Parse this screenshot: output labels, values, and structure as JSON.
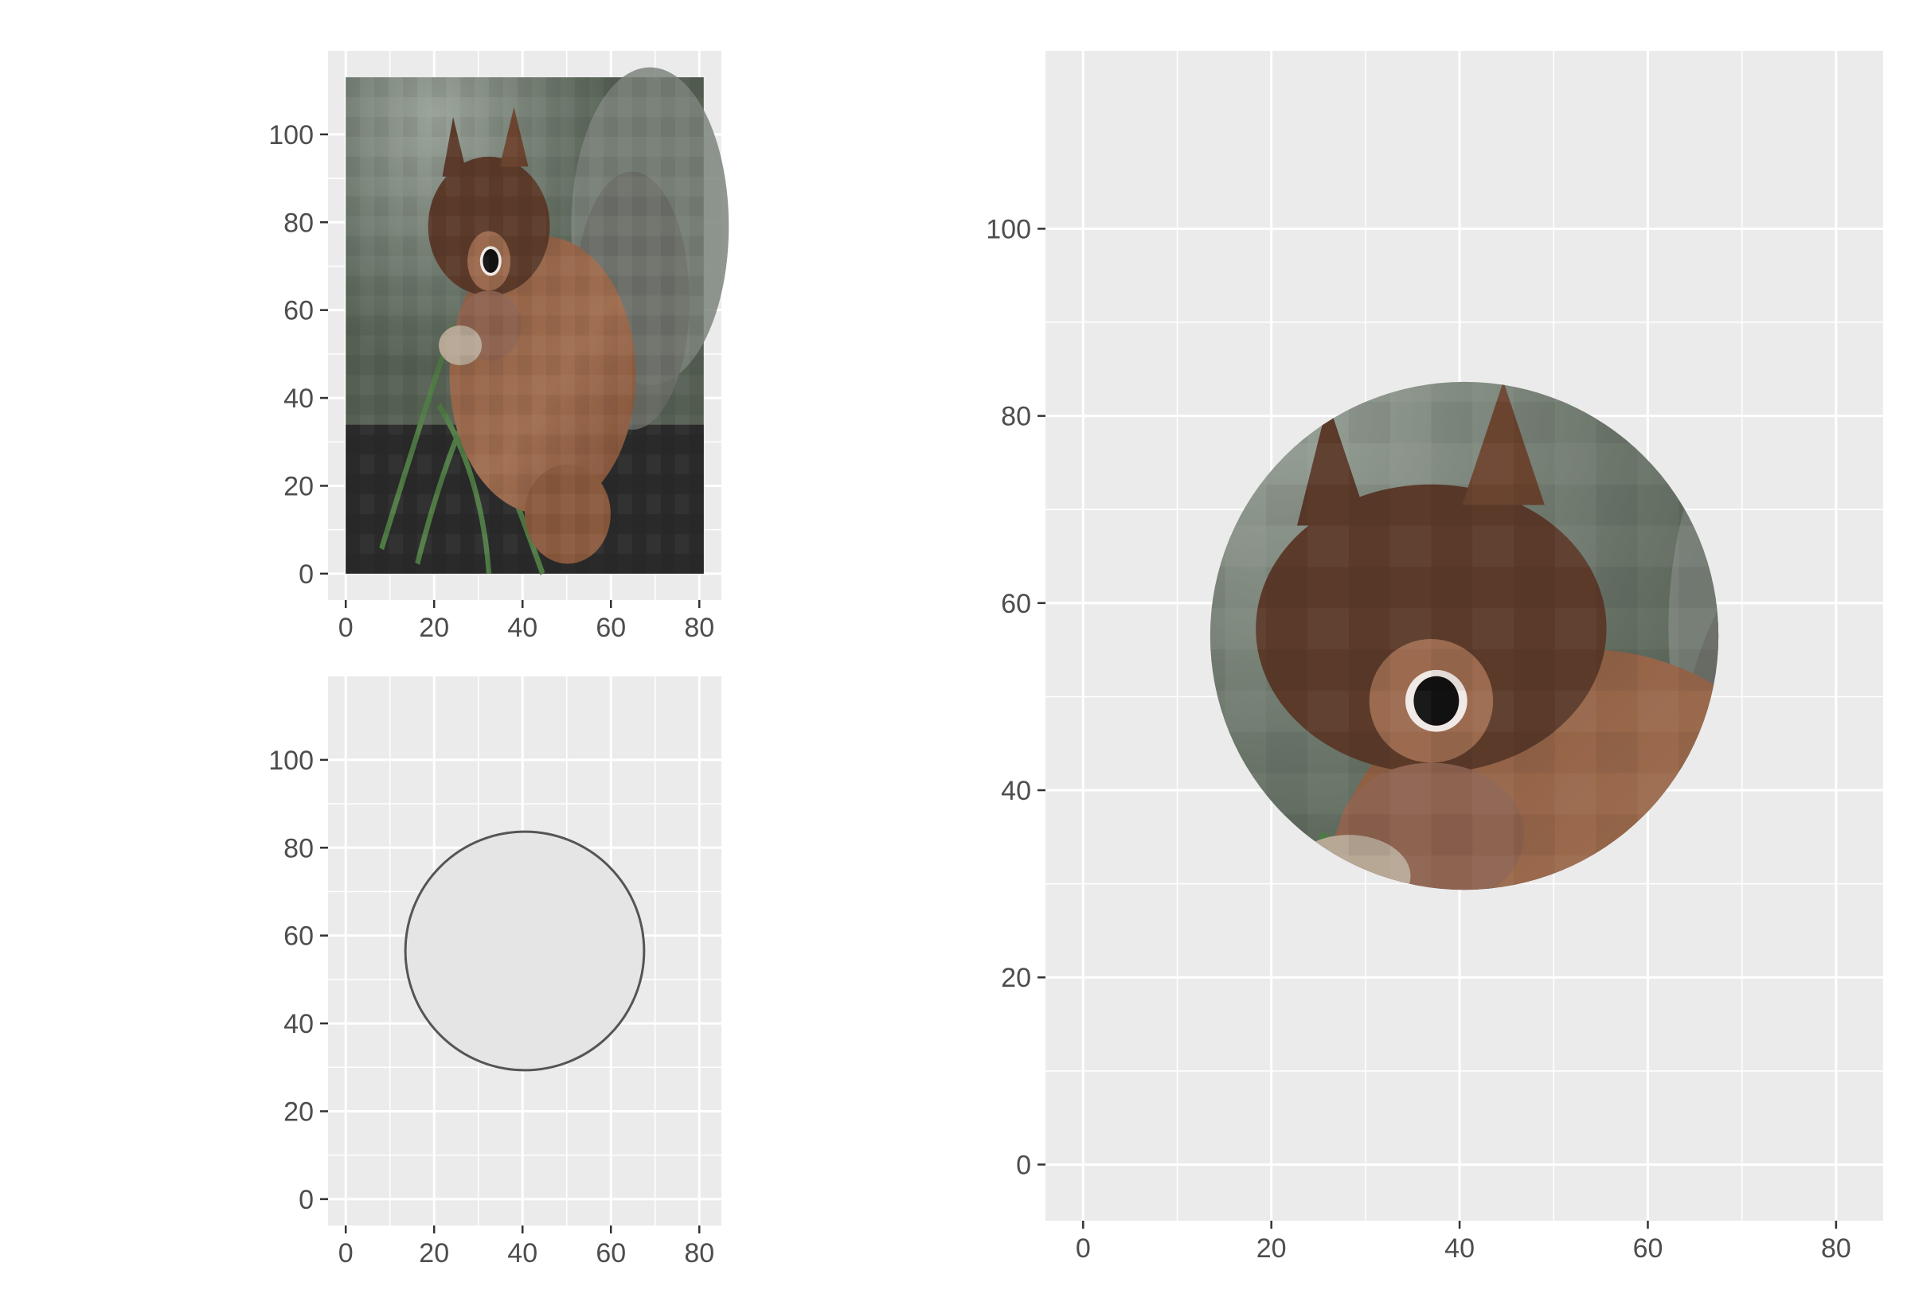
{
  "colors": {
    "panel_background": "#ebebeb",
    "grid_line": "#ffffff",
    "tick_mark": "#333333",
    "tick_text": "#4d4d4d",
    "circle_fill": "#e5e5e5",
    "circle_stroke": "#555555"
  },
  "chart_data": [
    {
      "id": "raster-image-panel",
      "type": "image",
      "xlim": [
        -4,
        85
      ],
      "ylim": [
        -6,
        119
      ],
      "x_ticks": [
        0,
        20,
        40,
        60,
        80
      ],
      "x_tick_labels": [
        "0",
        "20",
        "40",
        "60",
        "80"
      ],
      "y_ticks": [
        0,
        20,
        40,
        60,
        80,
        100
      ],
      "y_tick_labels": [
        "0",
        "20",
        "40",
        "60",
        "80",
        "100"
      ],
      "image_extent": {
        "x": [
          0,
          81
        ],
        "y": [
          0,
          113
        ]
      },
      "image_content": "squirrel photo",
      "grid": true
    },
    {
      "id": "circle-outline-panel",
      "type": "shape",
      "xlim": [
        -4,
        85
      ],
      "ylim": [
        -6,
        119
      ],
      "x_ticks": [
        0,
        20,
        40,
        60,
        80
      ],
      "x_tick_labels": [
        "0",
        "20",
        "40",
        "60",
        "80"
      ],
      "y_ticks": [
        0,
        20,
        40,
        60,
        80,
        100
      ],
      "y_tick_labels": [
        "0",
        "20",
        "40",
        "60",
        "80",
        "100"
      ],
      "circle": {
        "cx": 40.5,
        "cy": 56.5,
        "r": 27
      },
      "grid": true
    },
    {
      "id": "masked-image-panel",
      "type": "image",
      "xlim": [
        -4,
        85
      ],
      "ylim": [
        -6,
        119
      ],
      "x_ticks": [
        0,
        20,
        40,
        60,
        80
      ],
      "x_tick_labels": [
        "0",
        "20",
        "40",
        "60",
        "80"
      ],
      "y_ticks": [
        0,
        20,
        40,
        60,
        80,
        100
      ],
      "y_tick_labels": [
        "0",
        "20",
        "40",
        "60",
        "80",
        "100"
      ],
      "circle": {
        "cx": 40.5,
        "cy": 56.5,
        "r": 27
      },
      "image_content": "squirrel photo clipped to circle",
      "grid": true
    }
  ]
}
